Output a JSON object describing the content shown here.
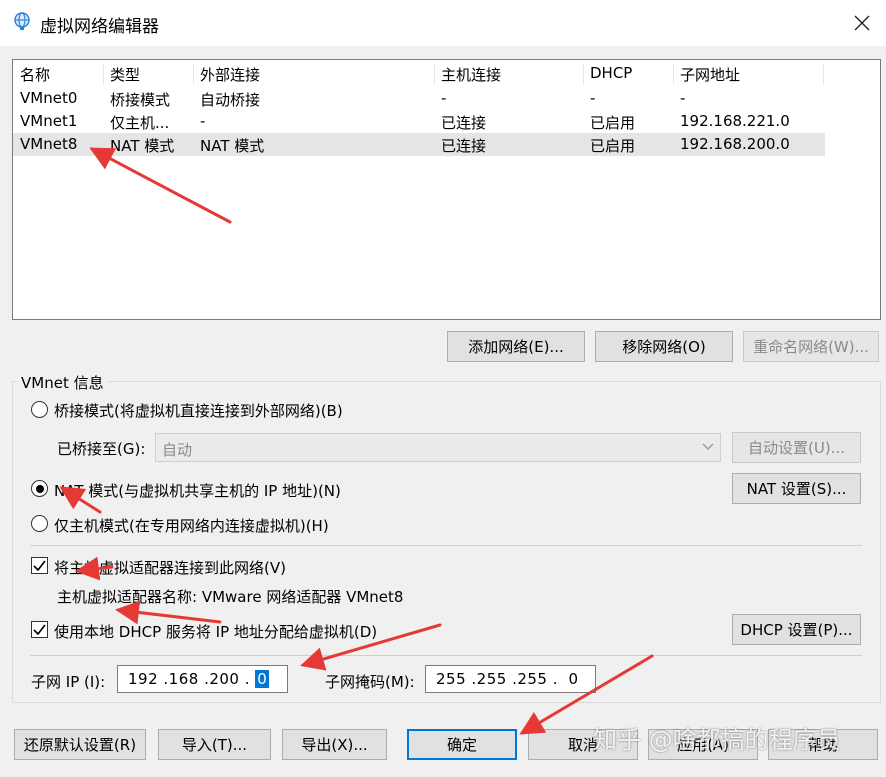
{
  "window": {
    "title": "虚拟网络编辑器",
    "icon": "globe-network-icon",
    "close_icon": "close-icon"
  },
  "network_list": {
    "columns": [
      "名称",
      "类型",
      "外部连接",
      "主机连接",
      "DHCP",
      "子网地址"
    ],
    "rows": [
      [
        "VMnet0",
        "桥接模式",
        "自动桥接",
        "-",
        "-",
        "-"
      ],
      [
        "VMnet1",
        "仅主机...",
        "-",
        "已连接",
        "已启用",
        "192.168.221.0"
      ],
      [
        "VMnet8",
        "NAT 模式",
        "NAT 模式",
        "已连接",
        "已启用",
        "192.168.200.0"
      ]
    ],
    "selected_row": 2
  },
  "list_buttons": {
    "add": "添加网络(E)...",
    "remove": "移除网络(O)",
    "rename": "重命名网络(W)..."
  },
  "vmnet_info": {
    "group_title": "VMnet 信息",
    "bridged_radio": "桥接模式(将虚拟机直接连接到外部网络)(B)",
    "bridged_to_label": "已桥接至(G):",
    "bridged_to_value": "自动",
    "auto_settings": "自动设置(U)...",
    "nat_radio": "NAT 模式(与虚拟机共享主机的 IP 地址)(N)",
    "nat_settings": "NAT 设置(S)...",
    "hostonly_radio": "仅主机模式(在专用网络内连接虚拟机)(H)",
    "selected_mode": "nat",
    "connect_adapter_check": "将主机虚拟适配器连接到此网络(V)",
    "connect_adapter_checked": true,
    "adapter_name": "主机虚拟适配器名称: VMware 网络适配器 VMnet8",
    "dhcp_check": "使用本地 DHCP 服务将 IP 地址分配给虚拟机(D)",
    "dhcp_checked": true,
    "dhcp_settings": "DHCP 设置(P)...",
    "subnet_ip_label": "子网 IP (I):",
    "subnet_ip_value": "192 .168 .200 . ",
    "subnet_ip_last": "0",
    "subnet_mask_label": "子网掩码(M):",
    "subnet_mask_value": "255 .255 .255 .  0"
  },
  "footer_buttons": {
    "restore": "还原默认设置(R)",
    "import": "导入(T)...",
    "export": "导出(X)...",
    "ok": "确定",
    "cancel": "取消",
    "apply": "应用(A)",
    "help": "帮助"
  },
  "watermark": "知乎 @啥都搞的程序员",
  "annotation_color": "#e53935"
}
